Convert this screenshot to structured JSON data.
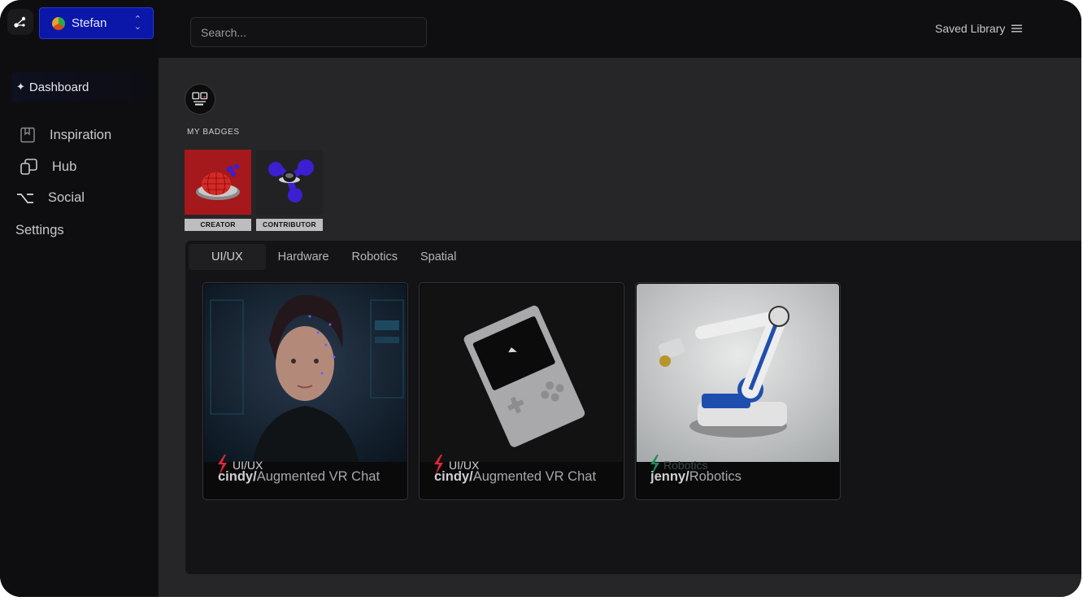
{
  "sidebar": {
    "account_name": "Stefan",
    "dashboard_label": "Dashboard",
    "items": [
      {
        "label": "Inspiration",
        "icon": "bookmark-icon"
      },
      {
        "label": "Hub",
        "icon": "copy-icon"
      },
      {
        "label": "Social",
        "icon": "option-key-icon"
      },
      {
        "label": "Settings"
      }
    ]
  },
  "header": {
    "search_placeholder": "Search...",
    "saved_library_label": "Saved Library"
  },
  "badges": {
    "label": "MY BADGES",
    "items": [
      {
        "caption": "CREATOR"
      },
      {
        "caption": "CONTRIBUTOR"
      }
    ]
  },
  "tabs": [
    "UI/UX",
    "Hardware",
    "Robotics",
    "Spatial"
  ],
  "active_tab": "UI/UX",
  "cards": [
    {
      "tag": "UI/UX",
      "user": "cindy/",
      "project": "Augmented VR Chat",
      "tag_color": "#e0263a"
    },
    {
      "tag": "UI/UX",
      "user": "cindy/",
      "project": "Augmented VR Chat",
      "tag_color": "#e0263a"
    },
    {
      "tag": "Robotics",
      "user": "jenny/",
      "project": "Robotics",
      "tag_color": "#1f8a5a"
    }
  ],
  "colors": {
    "accent": "#0b17a9",
    "background": "#0e0e10",
    "main_background": "#262628"
  }
}
